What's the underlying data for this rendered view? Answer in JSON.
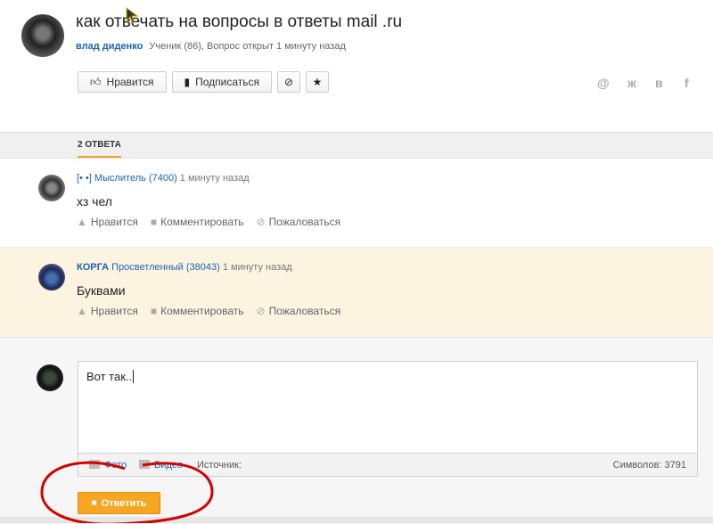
{
  "question": {
    "title": "как отвечать на вопросы в ответы mail .ru",
    "author": "влад диденко",
    "meta": "Ученик (86), Вопрос открыт 1 минуту назад",
    "buttons": {
      "like": "Нравится",
      "subscribe": "Подписаться"
    },
    "share_icons": [
      "at-icon",
      "odnoklassniki-icon",
      "vk-icon",
      "facebook-icon"
    ],
    "share_glyphs": {
      "at": "@",
      "ok": "ж",
      "vk": "в",
      "fb": "f"
    }
  },
  "tabs": {
    "answers": "2 ОТВЕТА"
  },
  "answers": [
    {
      "author": "[• •] Мыслитель (7400)",
      "time": "1 минуту назад",
      "text": "хз чел",
      "actions": {
        "like": "Нравится",
        "comment": "Комментировать",
        "report": "Пожаловаться"
      }
    },
    {
      "author": "КОРГА",
      "rank": "Просветленный (38043)",
      "time": "1 минуту назад",
      "text": "Буквами",
      "actions": {
        "like": "Нравится",
        "comment": "Комментировать",
        "report": "Пожаловаться"
      }
    }
  ],
  "reply": {
    "value": "Вот так..",
    "photo": "Фото",
    "video": "Видео",
    "source": "Источник:",
    "counter": "Символов: 3791",
    "submit": "Ответить"
  },
  "colors": {
    "accent": "#f5a623",
    "link": "#1a64b4",
    "highlight_bg": "#fdf3e1",
    "annotation": "#d40000"
  }
}
